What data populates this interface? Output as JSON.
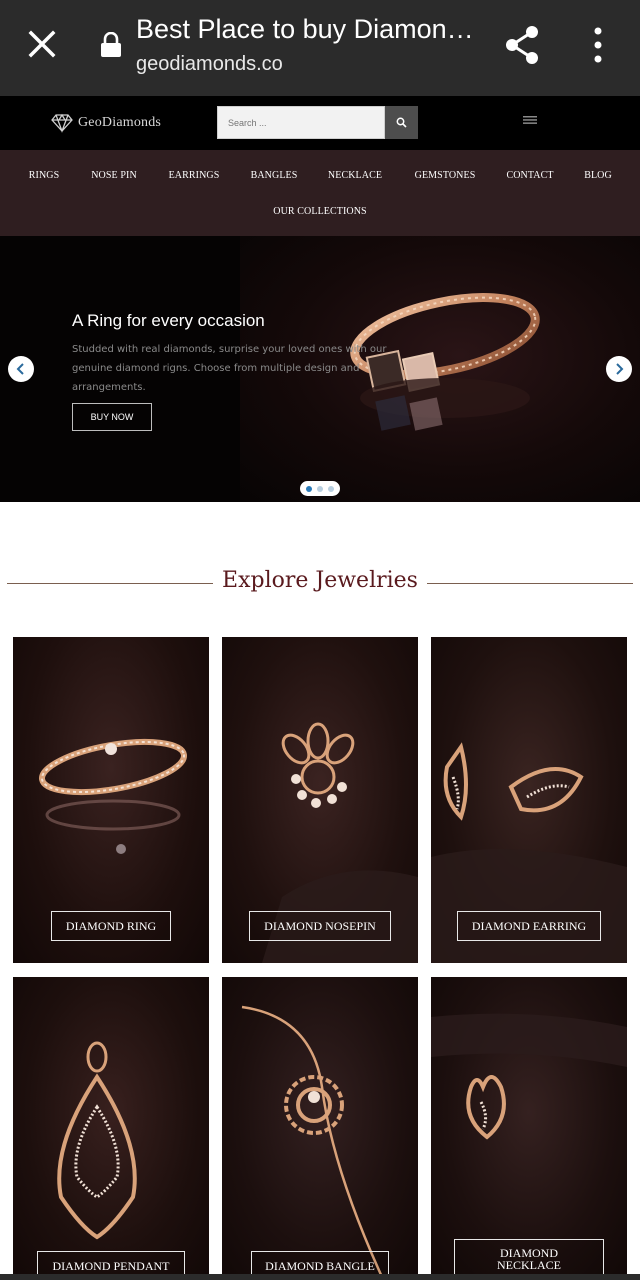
{
  "browser": {
    "title": "Best Place to buy Diamond Jewellery",
    "url": "geodiamonds.co",
    "icons": [
      "close-icon",
      "lock-icon",
      "share-icon",
      "more-icon"
    ]
  },
  "site": {
    "logo_text": "GeoDiamonds",
    "search_placeholder": "Search ...",
    "nav": [
      "RINGS",
      "NOSE PIN",
      "EARRINGS",
      "BANGLES",
      "NECKLACE",
      "GEMSTONES",
      "CONTACT",
      "BLOG",
      "OUR COLLECTIONS"
    ]
  },
  "hero": {
    "heading": "A Ring for every occasion",
    "text": "Studded with real diamonds, surprise your loved ones with our genuine diamond rigns. Choose from multiple design and arrangements.",
    "button": "BUY NOW",
    "slides": 3,
    "active_slide": 1
  },
  "section": {
    "title": "Explore Jewelries"
  },
  "products": [
    {
      "label": "DIAMOND RING"
    },
    {
      "label": "DIAMOND NOSEPIN"
    },
    {
      "label": "DIAMOND EARRING"
    },
    {
      "label": "DIAMOND PENDANT"
    },
    {
      "label": "DIAMOND BANGLE"
    },
    {
      "label": "DIAMOND NECKLACE"
    }
  ],
  "colors": {
    "chrome": "#2b2b2b",
    "nav_bg": "#2f1e20",
    "accent": "#5a1a1e",
    "gold": "#d9a27a"
  }
}
